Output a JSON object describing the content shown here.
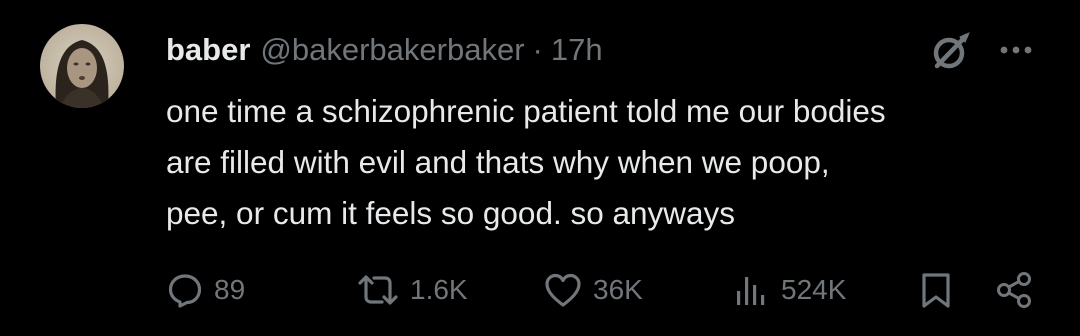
{
  "author": {
    "display_name": "baber",
    "handle": "@bakerbakerbaker",
    "separator": "·",
    "timestamp": "17h"
  },
  "tweet": {
    "lines": [
      "one time a schizophrenic patient told me our bodies",
      "are filled with evil and thats why when we poop,",
      "pee, or cum it feels so good. so anyways"
    ]
  },
  "actions": {
    "replies": "89",
    "reposts": "1.6K",
    "likes": "36K",
    "views": "524K"
  },
  "icons": {
    "grok": "grok-icon",
    "more": "more-icon",
    "reply": "reply-icon",
    "repost": "repost-icon",
    "like": "heart-icon",
    "views": "views-icon",
    "bookmark": "bookmark-icon",
    "share": "share-icon"
  },
  "colors": {
    "background": "#000000",
    "text_primary": "#e7e9ea",
    "text_secondary": "#71767b"
  }
}
